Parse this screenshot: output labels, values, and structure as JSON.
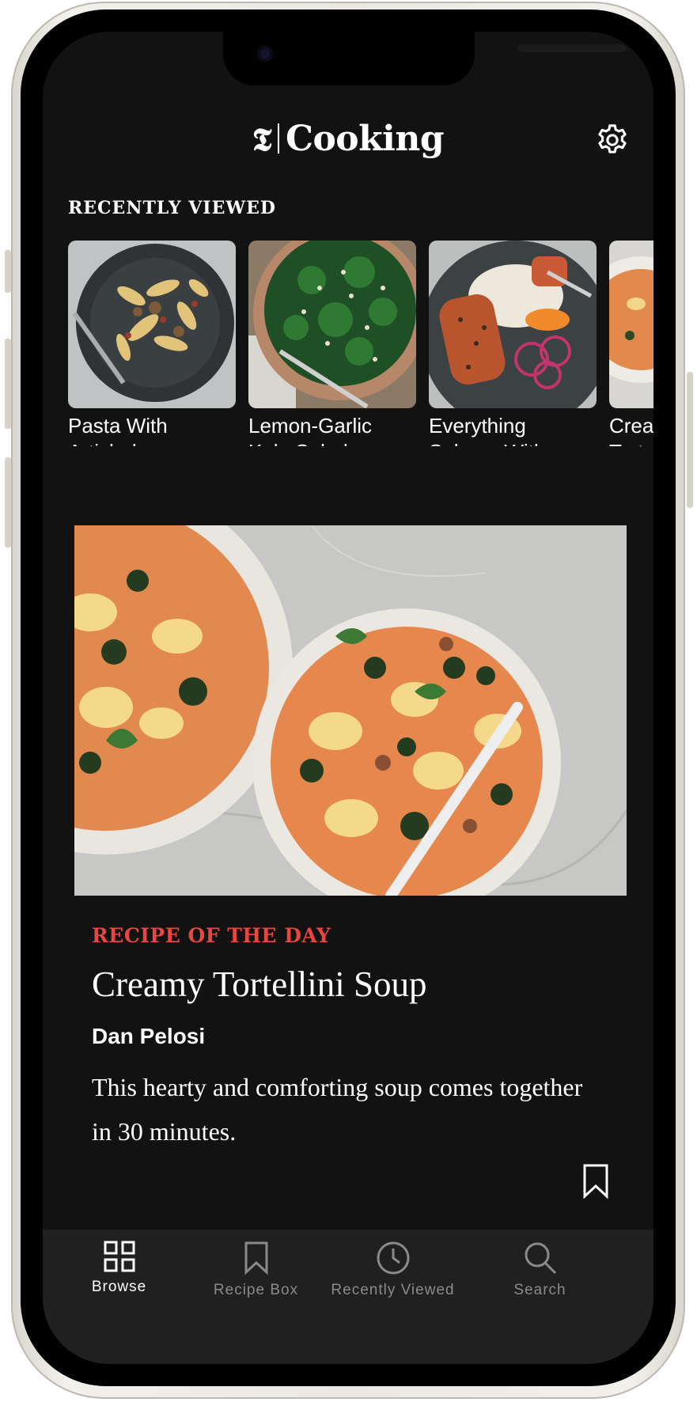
{
  "header": {
    "logo_text": "Cooking",
    "logo_mark": "𝕿"
  },
  "recently_viewed": {
    "title": "RECENTLY VIEWED",
    "items": [
      {
        "line1": "Pasta With",
        "line2": "Artichokes an..."
      },
      {
        "line1": "Lemon-Garlic",
        "line2": "Kale Salad"
      },
      {
        "line1": "Everything",
        "line2": "Salmon With..."
      },
      {
        "line1": "Crea",
        "line2": "Torte"
      }
    ]
  },
  "feature": {
    "label": "RECIPE OF THE DAY",
    "title": "Creamy Tortellini Soup",
    "author": "Dan Pelosi",
    "description": "This hearty and comforting soup comes together in 30 minutes."
  },
  "tabs": [
    {
      "label": "Browse",
      "icon": "grid-icon",
      "active": true
    },
    {
      "label": "Recipe Box",
      "icon": "bookmark-icon",
      "active": false
    },
    {
      "label": "Recently Viewed",
      "icon": "clock-icon",
      "active": false
    },
    {
      "label": "Search",
      "icon": "search-icon",
      "active": false
    }
  ],
  "colors": {
    "accent": "#e9463f",
    "background": "#121212",
    "tabbar": "#202020"
  }
}
